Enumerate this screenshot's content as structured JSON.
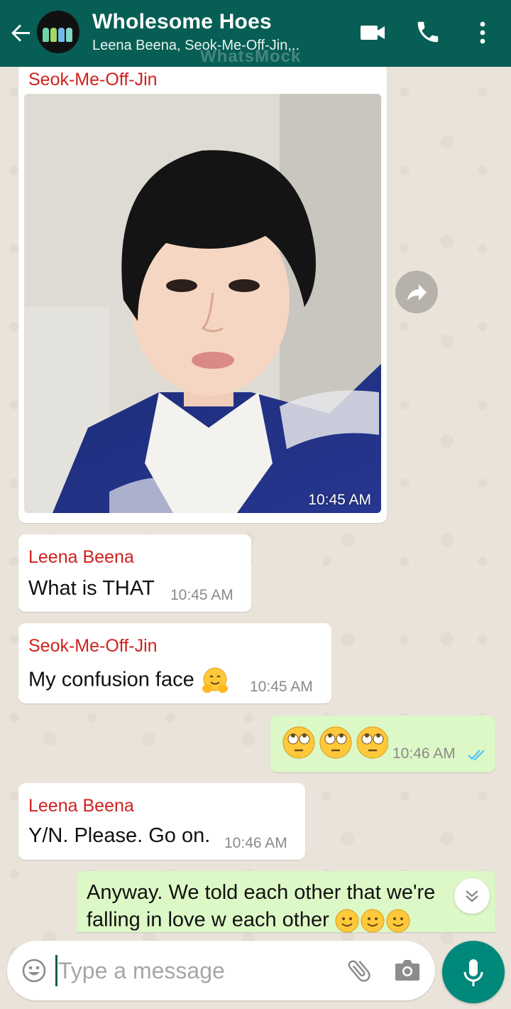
{
  "header": {
    "title": "Wholesome Hoes",
    "subtitle": "Leena Beena, Seok-Me-Off-Jin,..",
    "watermark": "WhatsMock"
  },
  "messages": [
    {
      "sender": "Seok-Me-Off-Jin",
      "type": "image",
      "time": "10:45 AM"
    },
    {
      "sender": "Leena Beena",
      "text": "What is THAT",
      "time": "10:45 AM"
    },
    {
      "sender": "Seok-Me-Off-Jin",
      "text": "My confusion face",
      "emoji": "hugging-face",
      "time": "10:45 AM"
    },
    {
      "outgoing": true,
      "emoji": "eye-roll x3",
      "time": "10:46 AM",
      "status": "read"
    },
    {
      "sender": "Leena Beena",
      "text": "Y/N. Please. Go on.",
      "time": "10:46 AM"
    },
    {
      "outgoing": true,
      "line1": "Anyway. We told each other that we're",
      "line2": "falling in love w each other",
      "emoji": "smile x3"
    }
  ],
  "composer": {
    "placeholder": "Type a message"
  },
  "colors": {
    "header": "#075e54",
    "outgoing_bubble": "#dcf8c6",
    "sender_name": "#d0211f",
    "mic_button": "#00897b",
    "read_ticks": "#4fc3f7"
  }
}
